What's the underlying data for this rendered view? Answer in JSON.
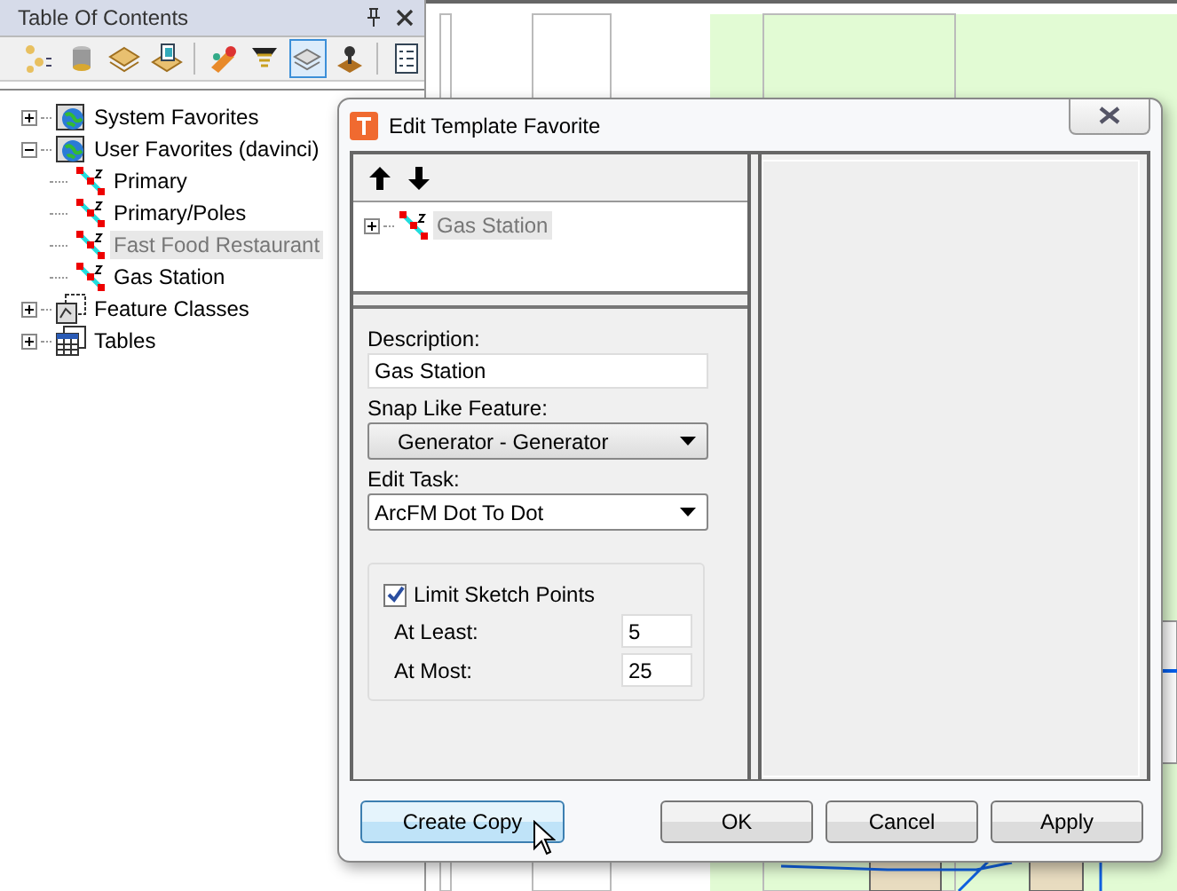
{
  "toc": {
    "title": "Table Of Contents",
    "toolbar": [
      {
        "selected": false
      },
      {
        "selected": false
      },
      {
        "selected": false
      },
      {
        "selected": false
      },
      {
        "selected": false
      },
      {
        "selected": false
      },
      {
        "selected": true
      },
      {
        "selected": false
      },
      {
        "selected": false
      }
    ],
    "tree": [
      {
        "label": "System Favorites",
        "kind": "favorites",
        "expanded": false,
        "selected": false
      },
      {
        "label": "User Favorites (davinci)",
        "kind": "favorites",
        "expanded": true,
        "selected": false,
        "children": [
          {
            "label": "Primary",
            "selected": false
          },
          {
            "label": "Primary/Poles",
            "selected": false
          },
          {
            "label": "Fast Food Restaurant",
            "selected": true
          },
          {
            "label": "Gas Station",
            "selected": false
          }
        ]
      },
      {
        "label": "Feature Classes",
        "kind": "classes",
        "expanded": false,
        "selected": false
      },
      {
        "label": "Tables",
        "kind": "tables",
        "expanded": false,
        "selected": false
      }
    ]
  },
  "dialog": {
    "title": "Edit Template Favorite",
    "tree": [
      {
        "label": "Gas Station",
        "expanded": false,
        "selected": true
      }
    ],
    "description": {
      "label": "Description:",
      "value": "Gas Station"
    },
    "snap_like_feature": {
      "label": "Snap Like Feature:",
      "value": "Generator - Generator"
    },
    "edit_task": {
      "label": "Edit Task:",
      "value": "ArcFM Dot To Dot"
    },
    "limit_sketch_points": {
      "label": "Limit Sketch Points",
      "checked": true
    },
    "at_least": {
      "label": "At Least:",
      "value": "5"
    },
    "at_most": {
      "label": "At Most:",
      "value": "25"
    },
    "buttons": [
      {
        "label": "Create Copy",
        "hovered": true
      },
      {
        "label": "OK",
        "hovered": false
      },
      {
        "label": "Cancel",
        "hovered": false
      },
      {
        "label": "Apply",
        "hovered": false
      }
    ]
  }
}
